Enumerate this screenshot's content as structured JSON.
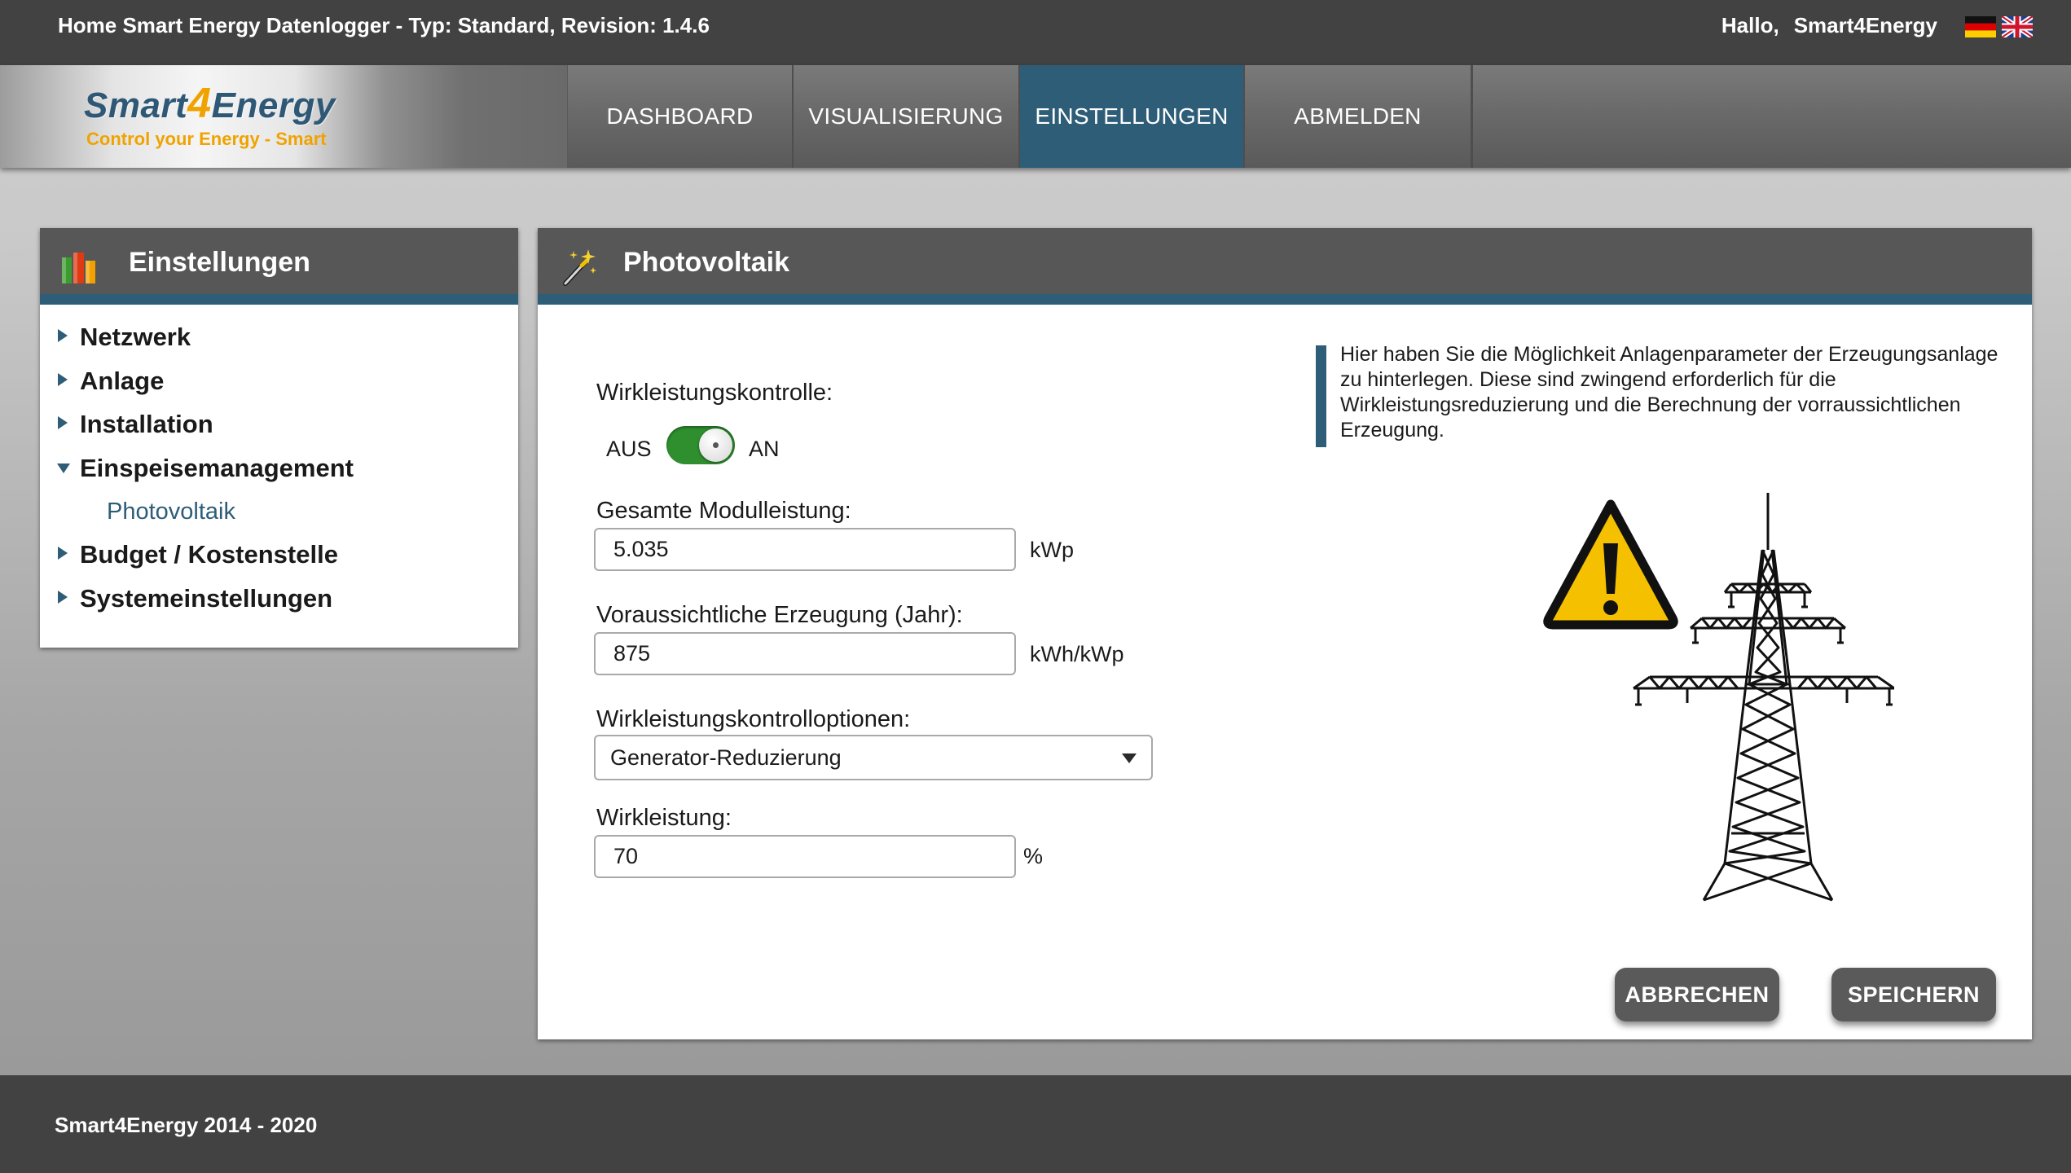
{
  "header": {
    "title": "Home Smart Energy Datenlogger - Typ: Standard, Revision: 1.4.6",
    "greeting": "Hallo,",
    "username": "Smart4Energy",
    "languages": [
      {
        "icon": "flag-de-icon"
      },
      {
        "icon": "flag-gb-icon"
      }
    ]
  },
  "brand": {
    "name": "Smart4Energy",
    "logo_line1": "Smart 4 Energy",
    "slogan": "Control your Energy - Smart",
    "colors": {
      "primary": "#2e5876",
      "accent": "#f0a300"
    }
  },
  "nav": {
    "items": [
      {
        "label": "DASHBOARD",
        "active": false
      },
      {
        "label": "VISUALISIERUNG",
        "active": false
      },
      {
        "label": "EINSTELLUNGEN",
        "active": true
      },
      {
        "label": "ABMELDEN",
        "active": false
      }
    ],
    "active_color": "#2e5d78"
  },
  "sidebar": {
    "title": "Einstellungen",
    "icon": "bar-chart-icon",
    "items": [
      {
        "label": "Netzwerk",
        "expanded": false
      },
      {
        "label": "Anlage",
        "expanded": false
      },
      {
        "label": "Installation",
        "expanded": false
      },
      {
        "label": "Einspeisemanagement",
        "expanded": true,
        "children": [
          {
            "label": "Photovoltaik"
          }
        ]
      },
      {
        "label": "Budget / Kostenstelle",
        "expanded": false
      },
      {
        "label": "Systemeinstellungen",
        "expanded": false
      }
    ]
  },
  "main": {
    "title": "Photovoltaik",
    "icon": "magic-wand-icon",
    "form": {
      "wirkleistungskontrolle": {
        "label": "Wirkleistungskontrolle:",
        "off_label": "AUS",
        "on_label": "AN",
        "state": "on"
      },
      "modulleistung": {
        "label": "Gesamte Modulleistung:",
        "value": "5.035",
        "unit": "kWp"
      },
      "erzeugung": {
        "label": "Voraussichtliche Erzeugung (Jahr):",
        "value": "875",
        "unit": "kWh/kWp"
      },
      "kontrolloptionen": {
        "label": "Wirkleistungskontrolloptionen:",
        "selected": "Generator-Reduzierung"
      },
      "wirkleistung": {
        "label": "Wirkleistung:",
        "value": "70",
        "unit": "%"
      }
    },
    "info": "Hier haben Sie die Möglichkeit Anlagenparameter der Erzeugungsanlage zu hinterlegen. Diese sind zwingend erforderlich für die Wirkleistungsreduzierung und die Berechnung der vorraussichtlichen Erzeugung.",
    "illustration": {
      "icons": [
        "warning-sign-icon",
        "power-pylon-icon"
      ],
      "warning_color": "#f5c000"
    },
    "buttons": {
      "cancel": "ABBRECHEN",
      "save": "SPEICHERN"
    }
  },
  "footer": {
    "copyright": "Smart4Energy 2014 - 2020"
  }
}
